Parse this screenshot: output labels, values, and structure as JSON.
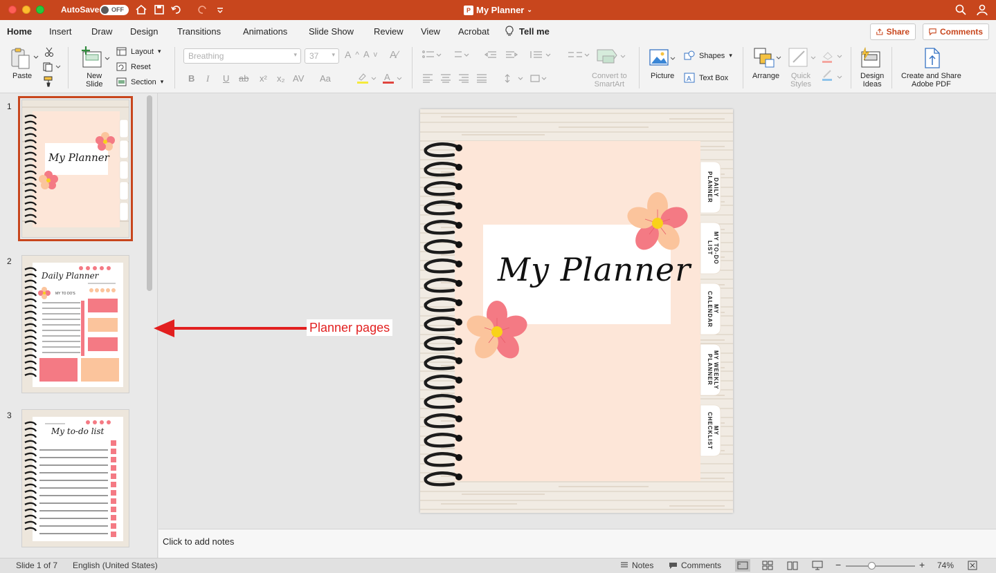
{
  "titlebar": {
    "autosave_label": "AutoSave",
    "autosave_state": "OFF",
    "document_title": "My Planner",
    "bg_color": "#c8461d"
  },
  "tabs": [
    "Home",
    "Insert",
    "Draw",
    "Design",
    "Transitions",
    "Animations",
    "Slide Show",
    "Review",
    "View",
    "Acrobat",
    "Tell me"
  ],
  "active_tab": "Home",
  "share_label": "Share",
  "comments_label": "Comments",
  "ribbon": {
    "paste": "Paste",
    "new_slide": [
      "New",
      "Slide"
    ],
    "layout": "Layout",
    "reset": "Reset",
    "section": "Section",
    "font_name": "Breathing",
    "font_size": "37",
    "convert_smartart": [
      "Convert to",
      "SmartArt"
    ],
    "picture": "Picture",
    "shapes": "Shapes",
    "text_box": "Text Box",
    "arrange": "Arrange",
    "quick_styles": [
      "Quick",
      "Styles"
    ],
    "design_ideas": [
      "Design",
      "Ideas"
    ],
    "adobe_pdf": [
      "Create and Share",
      "Adobe PDF"
    ],
    "format_buttons": [
      "B",
      "I",
      "U",
      "ab",
      "x²",
      "x₂"
    ]
  },
  "thumbnails": [
    {
      "num": "1",
      "title": "My Planner"
    },
    {
      "num": "2",
      "title": "Daily Planner",
      "todo": "MY TO DO'S"
    },
    {
      "num": "3",
      "title": "My to-do list"
    }
  ],
  "slide": {
    "title": "My Planner",
    "tabs": [
      "DAILY PLANNER",
      "MY TO-DO LIST",
      "MY CALENDAR",
      "MY WEEKLY PLANNER",
      "MY CHECKLIST"
    ]
  },
  "annotation": "Planner pages",
  "notes_placeholder": "Click to add notes",
  "status": {
    "slide_info": "Slide 1 of 7",
    "language": "English (United States)",
    "notes": "Notes",
    "comments": "Comments",
    "zoom": "74%"
  },
  "colors": {
    "accent": "#c8461d",
    "annotation": "#e21f1f",
    "slide_panel": "#fde6d8",
    "flower_pink": "#f47a84",
    "flower_peach": "#fbc49c",
    "flower_center": "#f9d21a"
  }
}
